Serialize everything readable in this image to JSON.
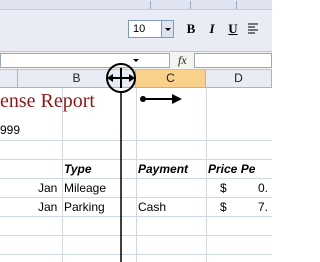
{
  "toolbar": {
    "font_size": "10",
    "bold_label": "B",
    "italic_label": "I",
    "underline_label": "U",
    "icons": [
      "size-dropdown-icon",
      "bold-icon",
      "italic-icon",
      "underline-icon",
      "align-left-icon"
    ]
  },
  "formula_bar": {
    "fx_label": "fx"
  },
  "columns": {
    "b": "B",
    "c": "C",
    "d": "D"
  },
  "sheet": {
    "title": "ense Report",
    "row2_a": "999",
    "headers": {
      "type": "Type",
      "payment": "Payment",
      "price": "Price Pe"
    },
    "rows": [
      {
        "date": "Jan",
        "type": "Mileage",
        "payment": "",
        "currency": "$",
        "price": "0."
      },
      {
        "date": "Jan",
        "type": "Parking",
        "payment": "Cash",
        "currency": "$",
        "price": "7."
      }
    ]
  },
  "colors": {
    "selected_column_header": "#f9d18a",
    "title": "#8b1a1a",
    "gridline": "#d0d7e5"
  },
  "cursor": "column-resize-cursor"
}
